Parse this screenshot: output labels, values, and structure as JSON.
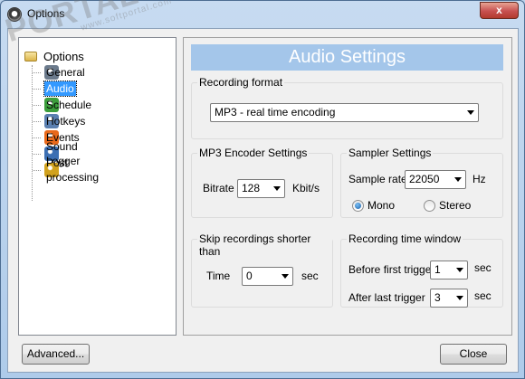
{
  "window": {
    "title": "Options"
  },
  "tree": {
    "root": "Options",
    "items": [
      {
        "label": "General",
        "icon": "general-icon",
        "color": "#6b7a8c"
      },
      {
        "label": "Audio",
        "icon": "speaker-icon",
        "color": "#e07a22",
        "selected": true
      },
      {
        "label": "Schedule",
        "icon": "clock-icon",
        "color": "#3c9e3c"
      },
      {
        "label": "Hotkeys",
        "icon": "keyboard-icon",
        "color": "#5a7fb0"
      },
      {
        "label": "Events",
        "icon": "events-icon",
        "color": "#e8691b"
      },
      {
        "label": "Sound Logger",
        "icon": "bar-chart-icon",
        "color": "#3c6fb3"
      },
      {
        "label": "Post processing",
        "icon": "gears-icon",
        "color": "#d1a21e"
      }
    ]
  },
  "panel": {
    "header": "Audio Settings",
    "recording_format": {
      "title": "Recording format",
      "value": "MP3 - real time encoding"
    },
    "mp3_encoder": {
      "title": "MP3 Encoder Settings",
      "bitrate_label": "Bitrate",
      "bitrate_value": "128",
      "bitrate_unit": "Kbit/s"
    },
    "sampler": {
      "title": "Sampler Settings",
      "rate_label": "Sample rate",
      "rate_value": "22050",
      "rate_unit": "Hz",
      "mono_label": "Mono",
      "stereo_label": "Stereo",
      "mode": "Mono"
    },
    "skip": {
      "title": "Skip recordings shorter than",
      "time_label": "Time",
      "time_value": "0",
      "time_unit": "sec"
    },
    "time_window": {
      "title": "Recording time window",
      "before_label": "Before first trigger",
      "before_value": "1",
      "before_unit": "sec",
      "after_label": "After last trigger",
      "after_value": "3",
      "after_unit": "sec"
    }
  },
  "buttons": {
    "advanced": "Advanced...",
    "close": "Close",
    "close_x": "x"
  },
  "watermark": {
    "text": "PORTAL",
    "subtext": "www.softportal.com"
  }
}
